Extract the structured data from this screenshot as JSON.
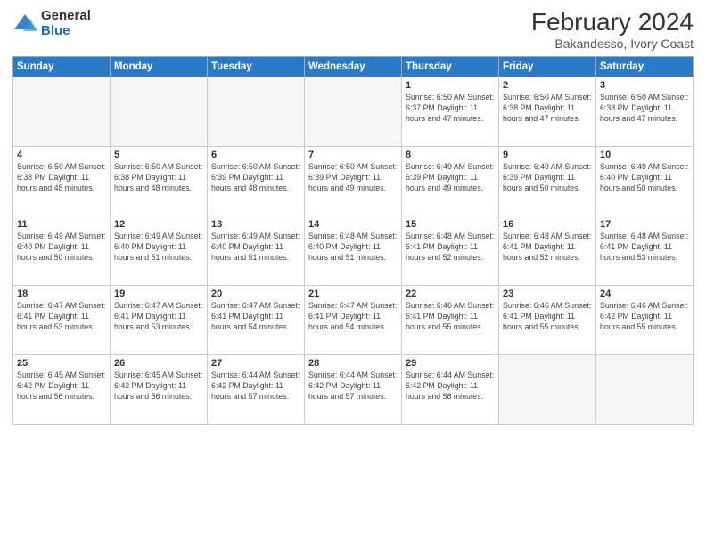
{
  "logo": {
    "general": "General",
    "blue": "Blue"
  },
  "title": "February 2024",
  "subtitle": "Bakandesso, Ivory Coast",
  "days_of_week": [
    "Sunday",
    "Monday",
    "Tuesday",
    "Wednesday",
    "Thursday",
    "Friday",
    "Saturday"
  ],
  "weeks": [
    [
      {
        "day": "",
        "info": ""
      },
      {
        "day": "",
        "info": ""
      },
      {
        "day": "",
        "info": ""
      },
      {
        "day": "",
        "info": ""
      },
      {
        "day": "1",
        "info": "Sunrise: 6:50 AM\nSunset: 6:37 PM\nDaylight: 11 hours and 47 minutes."
      },
      {
        "day": "2",
        "info": "Sunrise: 6:50 AM\nSunset: 6:38 PM\nDaylight: 11 hours and 47 minutes."
      },
      {
        "day": "3",
        "info": "Sunrise: 6:50 AM\nSunset: 6:38 PM\nDaylight: 11 hours and 47 minutes."
      }
    ],
    [
      {
        "day": "4",
        "info": "Sunrise: 6:50 AM\nSunset: 6:38 PM\nDaylight: 11 hours and 48 minutes."
      },
      {
        "day": "5",
        "info": "Sunrise: 6:50 AM\nSunset: 6:38 PM\nDaylight: 11 hours and 48 minutes."
      },
      {
        "day": "6",
        "info": "Sunrise: 6:50 AM\nSunset: 6:39 PM\nDaylight: 11 hours and 48 minutes."
      },
      {
        "day": "7",
        "info": "Sunrise: 6:50 AM\nSunset: 6:39 PM\nDaylight: 11 hours and 49 minutes."
      },
      {
        "day": "8",
        "info": "Sunrise: 6:49 AM\nSunset: 6:39 PM\nDaylight: 11 hours and 49 minutes."
      },
      {
        "day": "9",
        "info": "Sunrise: 6:49 AM\nSunset: 6:39 PM\nDaylight: 11 hours and 50 minutes."
      },
      {
        "day": "10",
        "info": "Sunrise: 6:49 AM\nSunset: 6:40 PM\nDaylight: 11 hours and 50 minutes."
      }
    ],
    [
      {
        "day": "11",
        "info": "Sunrise: 6:49 AM\nSunset: 6:40 PM\nDaylight: 11 hours and 50 minutes."
      },
      {
        "day": "12",
        "info": "Sunrise: 6:49 AM\nSunset: 6:40 PM\nDaylight: 11 hours and 51 minutes."
      },
      {
        "day": "13",
        "info": "Sunrise: 6:49 AM\nSunset: 6:40 PM\nDaylight: 11 hours and 51 minutes."
      },
      {
        "day": "14",
        "info": "Sunrise: 6:48 AM\nSunset: 6:40 PM\nDaylight: 11 hours and 51 minutes."
      },
      {
        "day": "15",
        "info": "Sunrise: 6:48 AM\nSunset: 6:41 PM\nDaylight: 11 hours and 52 minutes."
      },
      {
        "day": "16",
        "info": "Sunrise: 6:48 AM\nSunset: 6:41 PM\nDaylight: 11 hours and 52 minutes."
      },
      {
        "day": "17",
        "info": "Sunrise: 6:48 AM\nSunset: 6:41 PM\nDaylight: 11 hours and 53 minutes."
      }
    ],
    [
      {
        "day": "18",
        "info": "Sunrise: 6:47 AM\nSunset: 6:41 PM\nDaylight: 11 hours and 53 minutes."
      },
      {
        "day": "19",
        "info": "Sunrise: 6:47 AM\nSunset: 6:41 PM\nDaylight: 11 hours and 53 minutes."
      },
      {
        "day": "20",
        "info": "Sunrise: 6:47 AM\nSunset: 6:41 PM\nDaylight: 11 hours and 54 minutes."
      },
      {
        "day": "21",
        "info": "Sunrise: 6:47 AM\nSunset: 6:41 PM\nDaylight: 11 hours and 54 minutes."
      },
      {
        "day": "22",
        "info": "Sunrise: 6:46 AM\nSunset: 6:41 PM\nDaylight: 11 hours and 55 minutes."
      },
      {
        "day": "23",
        "info": "Sunrise: 6:46 AM\nSunset: 6:41 PM\nDaylight: 11 hours and 55 minutes."
      },
      {
        "day": "24",
        "info": "Sunrise: 6:46 AM\nSunset: 6:42 PM\nDaylight: 11 hours and 55 minutes."
      }
    ],
    [
      {
        "day": "25",
        "info": "Sunrise: 6:45 AM\nSunset: 6:42 PM\nDaylight: 11 hours and 56 minutes."
      },
      {
        "day": "26",
        "info": "Sunrise: 6:45 AM\nSunset: 6:42 PM\nDaylight: 11 hours and 56 minutes."
      },
      {
        "day": "27",
        "info": "Sunrise: 6:44 AM\nSunset: 6:42 PM\nDaylight: 11 hours and 57 minutes."
      },
      {
        "day": "28",
        "info": "Sunrise: 6:44 AM\nSunset: 6:42 PM\nDaylight: 11 hours and 57 minutes."
      },
      {
        "day": "29",
        "info": "Sunrise: 6:44 AM\nSunset: 6:42 PM\nDaylight: 11 hours and 58 minutes."
      },
      {
        "day": "",
        "info": ""
      },
      {
        "day": "",
        "info": ""
      }
    ]
  ]
}
